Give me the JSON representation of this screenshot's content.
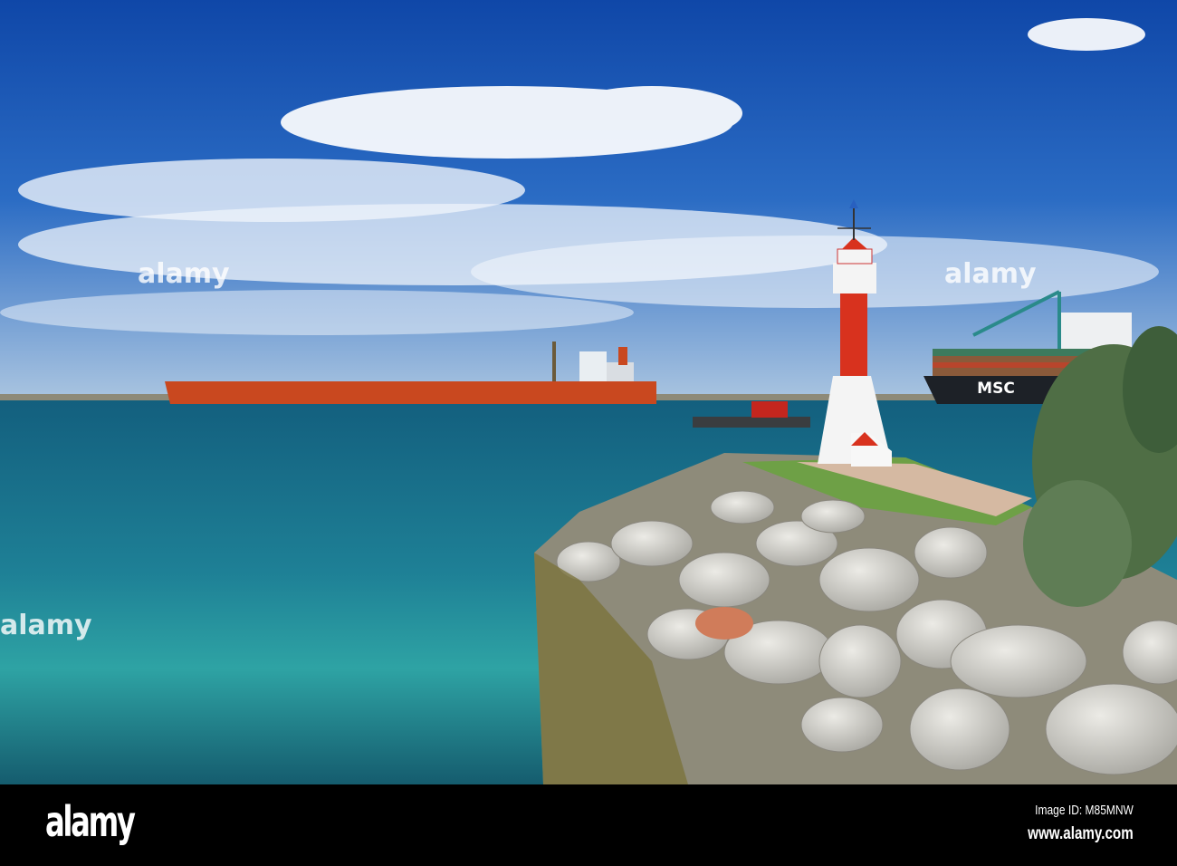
{
  "photo": {
    "ship_hull_text": "MSC",
    "watermark": "alamy"
  },
  "footer": {
    "logo": "alamy",
    "image_id": "Image ID: M85MNW",
    "website": "www.alamy.com"
  },
  "colors": {
    "sky": "#1a57b8",
    "sea": "#1f7f95",
    "lighthouse_red": "#d8321e",
    "tanker_hull": "#c9481f"
  }
}
